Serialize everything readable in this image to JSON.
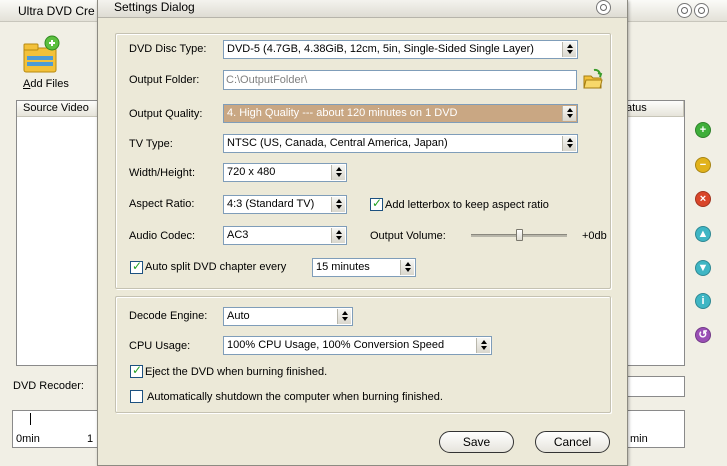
{
  "main": {
    "title": "Ultra DVD Cre",
    "add_files_label": "Add Files",
    "table_headers": {
      "source_video": "Source Video",
      "status": "atus"
    },
    "dvd_recoder_label": "DVD Recoder:",
    "timeline": {
      "start": "0min",
      "second": "1",
      "right": "min"
    }
  },
  "dialog": {
    "title": "Settings Dialog",
    "dvd_disc_type": {
      "label": "DVD Disc Type:",
      "value": "DVD-5    (4.7GB, 4.38GiB, 12cm, 5in, Single-Sided Single Layer)"
    },
    "output_folder": {
      "label": "Output Folder:",
      "value": "C:\\OutputFolder\\"
    },
    "output_quality": {
      "label": "Output Quality:",
      "value": "4. High   Quality --- about 120 minutes on 1 DVD"
    },
    "tv_type": {
      "label": "TV Type:",
      "value": "NTSC (US, Canada, Central America, Japan)"
    },
    "width_height": {
      "label": "Width/Height:",
      "value": "720 x 480"
    },
    "aspect_ratio": {
      "label": "Aspect Ratio:",
      "value": "4:3 (Standard TV)"
    },
    "letterbox": {
      "label": "Add letterbox to keep aspect ratio",
      "checked": true
    },
    "audio_codec": {
      "label": "Audio Codec:",
      "value": "AC3"
    },
    "output_volume": {
      "label": "Output Volume:",
      "value": "+0db",
      "level": 0.5
    },
    "auto_split": {
      "label": "Auto split DVD chapter every",
      "checked": true,
      "value": "15 minutes"
    },
    "decode_engine": {
      "label": "Decode Engine:",
      "value": "Auto"
    },
    "cpu_usage": {
      "label": "CPU Usage:",
      "value": "100% CPU Usage, 100% Conversion Speed"
    },
    "eject": {
      "label": "Eject the DVD when burning finished.",
      "checked": true
    },
    "shutdown": {
      "label": "Automatically shutdown the computer when  burning finished.",
      "checked": false
    },
    "save_label": "Save",
    "cancel_label": "Cancel"
  },
  "side_buttons": [
    {
      "icon": "add-icon",
      "color": "#3fae3a"
    },
    {
      "icon": "remove-icon",
      "color": "#e1b21b"
    },
    {
      "icon": "delete-icon",
      "color": "#d9462a"
    },
    {
      "icon": "move-up-icon",
      "color": "#3fb6c4"
    },
    {
      "icon": "move-down-icon",
      "color": "#3fb6c4"
    },
    {
      "icon": "info-icon",
      "color": "#3fb6c4"
    },
    {
      "icon": "undo-icon",
      "color": "#9a4fb5"
    }
  ],
  "colors": {
    "quality_highlight": "#c9a783",
    "field_border": "#7f9db9"
  }
}
